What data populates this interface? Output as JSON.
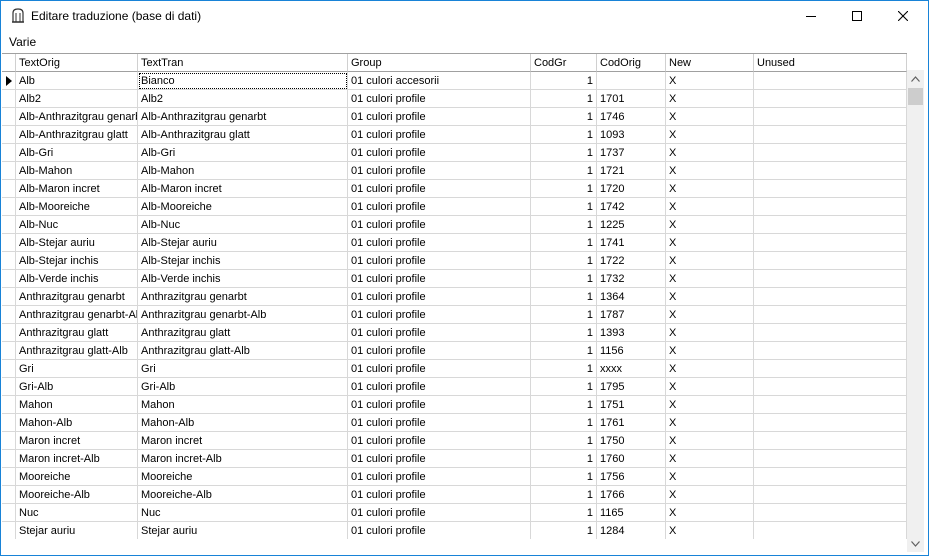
{
  "window": {
    "title": "Editare traduzione (base di dati)"
  },
  "menu": {
    "items": [
      "Varie"
    ]
  },
  "columns": [
    "TextOrig",
    "TextTran",
    "Group",
    "CodGr",
    "CodOrig",
    "New",
    "Unused"
  ],
  "rows": [
    [
      "Alb",
      "Bianco",
      "01 culori accesorii",
      "1",
      "",
      "X",
      ""
    ],
    [
      "Alb2",
      "Alb2",
      "01 culori profile",
      "1",
      "1701",
      "X",
      ""
    ],
    [
      "Alb-Anthrazitgrau genarbt",
      "Alb-Anthrazitgrau genarbt",
      "01 culori profile",
      "1",
      "1746",
      "X",
      ""
    ],
    [
      "Alb-Anthrazitgrau glatt",
      "Alb-Anthrazitgrau glatt",
      "01 culori profile",
      "1",
      "1093",
      "X",
      ""
    ],
    [
      "Alb-Gri",
      "Alb-Gri",
      "01 culori profile",
      "1",
      "1737",
      "X",
      ""
    ],
    [
      "Alb-Mahon",
      "Alb-Mahon",
      "01 culori profile",
      "1",
      "1721",
      "X",
      ""
    ],
    [
      "Alb-Maron incret",
      "Alb-Maron incret",
      "01 culori profile",
      "1",
      "1720",
      "X",
      ""
    ],
    [
      "Alb-Mooreiche",
      "Alb-Mooreiche",
      "01 culori profile",
      "1",
      "1742",
      "X",
      ""
    ],
    [
      "Alb-Nuc",
      "Alb-Nuc",
      "01 culori profile",
      "1",
      "1225",
      "X",
      ""
    ],
    [
      "Alb-Stejar auriu",
      "Alb-Stejar auriu",
      "01 culori profile",
      "1",
      "1741",
      "X",
      ""
    ],
    [
      "Alb-Stejar inchis",
      "Alb-Stejar inchis",
      "01 culori profile",
      "1",
      "1722",
      "X",
      ""
    ],
    [
      "Alb-Verde inchis",
      "Alb-Verde inchis",
      "01 culori profile",
      "1",
      "1732",
      "X",
      ""
    ],
    [
      "Anthrazitgrau genarbt",
      "Anthrazitgrau genarbt",
      "01 culori profile",
      "1",
      "1364",
      "X",
      ""
    ],
    [
      "Anthrazitgrau genarbt-Alb",
      "Anthrazitgrau genarbt-Alb",
      "01 culori profile",
      "1",
      "1787",
      "X",
      ""
    ],
    [
      "Anthrazitgrau glatt",
      "Anthrazitgrau glatt",
      "01 culori profile",
      "1",
      "1393",
      "X",
      ""
    ],
    [
      "Anthrazitgrau glatt-Alb",
      "Anthrazitgrau glatt-Alb",
      "01 culori profile",
      "1",
      "1156",
      "X",
      ""
    ],
    [
      "Gri",
      "Gri",
      "01 culori profile",
      "1",
      "xxxx",
      "X",
      ""
    ],
    [
      "Gri-Alb",
      "Gri-Alb",
      "01 culori profile",
      "1",
      "1795",
      "X",
      ""
    ],
    [
      "Mahon",
      "Mahon",
      "01 culori profile",
      "1",
      "1751",
      "X",
      ""
    ],
    [
      "Mahon-Alb",
      "Mahon-Alb",
      "01 culori profile",
      "1",
      "1761",
      "X",
      ""
    ],
    [
      "Maron incret",
      "Maron incret",
      "01 culori profile",
      "1",
      "1750",
      "X",
      ""
    ],
    [
      "Maron incret-Alb",
      "Maron incret-Alb",
      "01 culori profile",
      "1",
      "1760",
      "X",
      ""
    ],
    [
      "Mooreiche",
      "Mooreiche",
      "01 culori profile",
      "1",
      "1756",
      "X",
      ""
    ],
    [
      "Mooreiche-Alb",
      "Mooreiche-Alb",
      "01 culori profile",
      "1",
      "1766",
      "X",
      ""
    ],
    [
      "Nuc",
      "Nuc",
      "01 culori profile",
      "1",
      "1165",
      "X",
      ""
    ],
    [
      "Stejar auriu",
      "Stejar auriu",
      "01 culori profile",
      "1",
      "1284",
      "X",
      ""
    ]
  ],
  "selection": {
    "row": 0,
    "column": 1
  },
  "colors": {
    "window_border": "#1883d7",
    "grid_line": "#d8d8d8",
    "scrollbar": "#f0f0f0"
  }
}
